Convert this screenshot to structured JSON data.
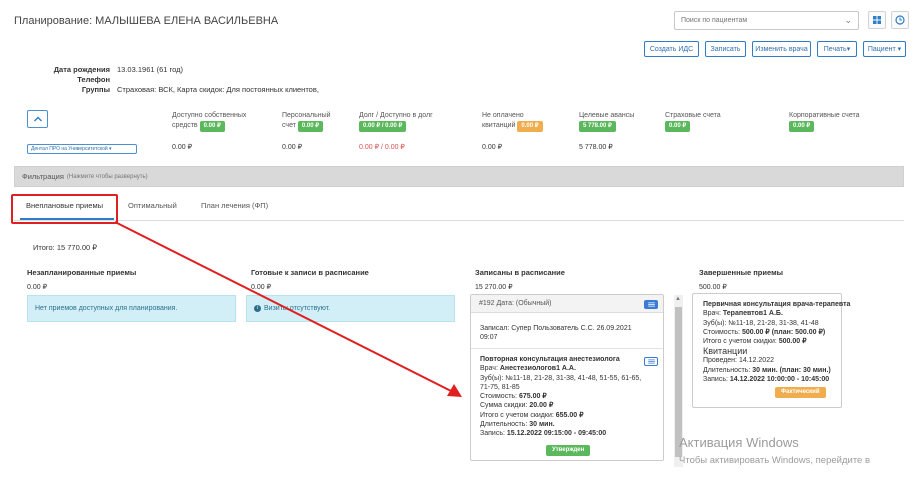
{
  "header": {
    "title": "Планирование: МАЛЫШЕВА ЕЛЕНА ВАСИЛЬЕВНА",
    "search_placeholder": "Поиск по пациентам"
  },
  "toolbar": {
    "create_ids": "Создать ИДС",
    "record": "Записать",
    "change_doctor": "Изменить врача",
    "print": "Печать▾",
    "patient": "Пациент ▾"
  },
  "patient_info": {
    "birth_label": "Дата рождения",
    "birth_value": "13.03.1961 (61 год)",
    "phone_label": "Телефон",
    "phone_value": "",
    "groups_label": "Группы",
    "groups_value": "Страховая: ВСК, Карта скидок: Для постоянных клиентов,"
  },
  "finance": {
    "dropdown": "Дентал ПРО на Университетской ▾",
    "cols": [
      {
        "label1": "Доступно собственных",
        "label2": "средств",
        "badge": "0.00 ₽",
        "badge_color": "green",
        "value": "0.00 ₽"
      },
      {
        "label1": "Персональный",
        "label2": "счет",
        "badge": "0.00 ₽",
        "badge_color": "green",
        "value": "0.00 ₽"
      },
      {
        "label1": "Долг / Доступно в долг",
        "label2": "",
        "badge": "0.00 ₽ / 0.00 ₽",
        "badge_color": "green",
        "value": "0.00 ₽ / 0.00 ₽"
      },
      {
        "label1": "Не оплачено",
        "label2": "квитанций",
        "badge": "0.00 ₽",
        "badge_color": "orange",
        "value": "0.00 ₽"
      },
      {
        "label1": "Целевые авансы",
        "label2": "",
        "badge": "5 778.00 ₽",
        "badge_color": "green",
        "value": "5 778.00 ₽"
      },
      {
        "label1": "Страховые счета",
        "label2": "",
        "badge": "0.00 ₽",
        "badge_color": "green",
        "value": ""
      },
      {
        "label1": "Корпоративные счета",
        "label2": "",
        "badge": "0.00 ₽",
        "badge_color": "green",
        "value": ""
      }
    ]
  },
  "filter": {
    "label": "Фильтрация",
    "hint": "(Нажмите чтобы развернуть)"
  },
  "tabs": [
    {
      "label": "Внеплановые приемы",
      "active": true
    },
    {
      "label": "Оптимальный",
      "active": false
    },
    {
      "label": "План лечения (ФП)",
      "active": false
    }
  ],
  "total": "Итого: 15 770.00 ₽",
  "columns": {
    "unplanned": {
      "title": "Незапланированные приемы",
      "sum": "0.00 ₽",
      "alert": "Нет приемов доступных для планирования."
    },
    "ready": {
      "title": "Готовые к записи в расписание",
      "sum": "0.00 ₽",
      "alert": "Визиты отсутствуют."
    },
    "scheduled": {
      "title": "Записаны в расписание",
      "sum": "15 270.00 ₽",
      "card_head": "#192 Дата: (Обычный)",
      "recorded_1": "Записал: Супер Пользователь С.С. 26.09.2021",
      "recorded_2": "09:07",
      "visit_title": "Повторная консультация анестезиолога",
      "doctor_label": "Врач:",
      "doctor": "Анестезиологов1 А.А.",
      "teeth_1": "Зуб(ы): №11-18, 21-28, 31-38, 41-48, 51-55, 61-65,",
      "teeth_2": "71-75, 81-85",
      "cost_label": "Стоимость:",
      "cost": "675.00 ₽",
      "discount_label": "Сумма скидки:",
      "discount": "20.00 ₽",
      "total_label": "Итого с учетом скидки:",
      "total": "655.00 ₽",
      "duration_label": "Длительность:",
      "duration": "30 мин.",
      "record_label": "Запись:",
      "record": "15.12.2022 09:15:00 - 09:45:00",
      "status": "Утвержден"
    },
    "done": {
      "title": "Завершенные приемы",
      "sum": "500.00 ₽",
      "visit_title": "Первичная консультация врача-терапевта",
      "doctor_label": "Врач:",
      "doctor": "Терапевтов1 А.Б.",
      "teeth": "Зуб(ы): №11-18, 21-28, 31-38, 41-48",
      "cost_label": "Стоимость:",
      "cost": "500.00 ₽ (план: 500.00 ₽)",
      "total_label": "Итого с учетом скидки:",
      "total": "500.00 ₽",
      "receipts": "Квитанции",
      "held_label": "Проведен:",
      "held": "14.12.2022",
      "duration_label": "Длительность:",
      "duration": "30 мин. (план: 30 мин.)",
      "record_label": "Запись:",
      "record": "14.12.2022 10:00:00 - 10:45:00",
      "status": "Фактический"
    }
  },
  "watermark": {
    "line1": "Активация Windows",
    "line2": "Чтобы активировать Windows, перейдите в"
  },
  "colors": {
    "accent": "#2f7dc8",
    "green": "#5cb85c",
    "orange": "#f0ad4e",
    "annotation_red": "#e02020"
  }
}
